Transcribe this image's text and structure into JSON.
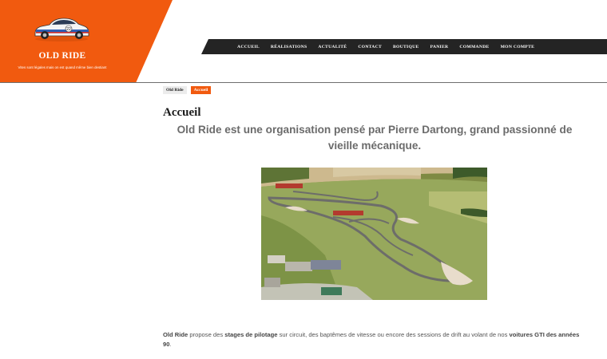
{
  "brand": {
    "title": "OLD RIDE",
    "tagline": "Vites sont légales mais on est quand même bien destiant",
    "logo_icon": "race-car-icon",
    "color": "#f15a0f"
  },
  "nav": {
    "items": [
      "ACCUEIL",
      "RÉALISATIONS",
      "ACTUALITÉ",
      "CONTACT",
      "BOUTIQUE",
      "PANIER",
      "COMMANDE",
      "MON COMPTE"
    ]
  },
  "breadcrumb": {
    "home": "Old Ride",
    "current": "Accueil"
  },
  "main": {
    "title": "Accueil",
    "intro": "Old Ride est une organisation pensé par Pierre Dartong, grand passionné de vieille mécanique.",
    "image_icon": "race-track-aerial-photo",
    "description": {
      "p1": "Old Ride",
      "p2": " propose des ",
      "p3": "stages de pilotage",
      "p4": " sur circuit, des baptêmes de vitesse ou encore des sessions de drift au volant de nos ",
      "p5": "voitures GTI des années 90",
      "p6": "."
    }
  }
}
